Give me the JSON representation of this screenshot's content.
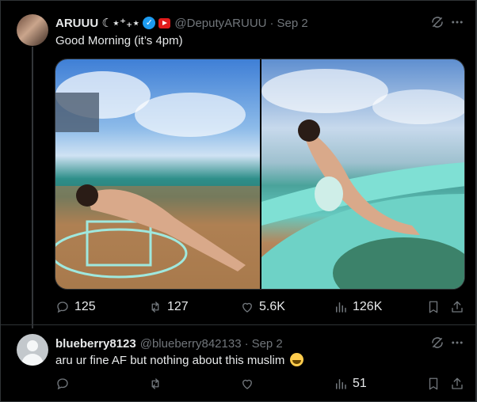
{
  "tweet": {
    "author_name": "ARUUU ☾⋆⁺₊⋆",
    "handle": "@DeputyARUUU",
    "date": "Sep 2",
    "text": "Good Morning (it’s 4pm)",
    "stats": {
      "replies": "125",
      "reposts": "127",
      "likes": "5.6K",
      "views": "126K"
    }
  },
  "reply": {
    "author_name": "blueberry8123",
    "handle": "@blueberry842133",
    "date": "Sep 2",
    "text": "aru ur fine AF but nothing about this muslim",
    "stats": {
      "views": "51"
    }
  },
  "colors": {
    "background": "#000000",
    "muted": "#71767b",
    "verified": "#1d9bf0",
    "border": "#2f3336"
  },
  "icons": [
    "grok-icon",
    "more-icon",
    "reply-icon",
    "repost-icon",
    "like-icon",
    "views-icon",
    "bookmark-icon",
    "share-icon",
    "verified-icon",
    "youtube-icon",
    "laughing-emoji"
  ]
}
